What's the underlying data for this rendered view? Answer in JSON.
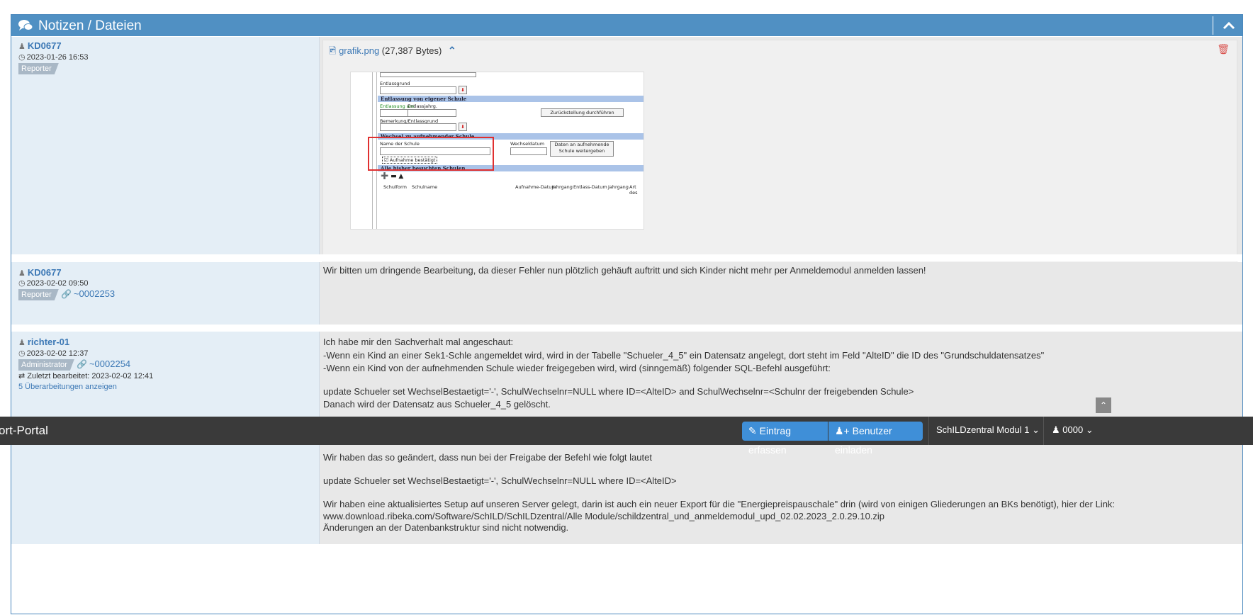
{
  "panel": {
    "title": "Notizen / Dateien"
  },
  "notes": [
    {
      "user": "KD0677",
      "date": "2023-01-26 16:53",
      "role": "Reporter",
      "file": {
        "name": "grafik.png",
        "size": "(27,387 Bytes)"
      }
    },
    {
      "user": "KD0677",
      "date": "2023-02-02 09:50",
      "role": "Reporter",
      "ref": "~0002253",
      "text": "Wir bitten um dringende Bearbeitung, da dieser Fehler nun plötzlich gehäuft auftritt und sich Kinder nicht mehr per Anmeldemodul anmelden lassen!"
    },
    {
      "user": "richter-01",
      "date": "2023-02-02 12:37",
      "role": "Administrator",
      "ref": "~0002254",
      "edited": "Zuletzt bearbeitet: 2023-02-02 12:41",
      "revisions": "5 Überarbeitungen anzeigen",
      "lines": [
        "Ich habe mir den Sachverhalt mal angeschaut:",
        "-Wenn ein Kind an einer Sek1-Schle angemeldet wird, wird in der Tabelle \"Schueler_4_5\" ein Datensatz angelegt, dort steht im Feld \"AlteID\" die ID des \"Grundschuldatensatzes\"",
        "-Wenn ein Kind von der aufnehmenden Schule wieder freigegeben wird, wird (sinngemäß) folgender SQL-Befehl ausgeführt:",
        "",
        "update Schueler set WechselBestaetigt='-', SchulWechselnr=NULL where ID=<AlteID> and SchulWechselnr=<Schulnr der freigebenden Schule>",
        "Danach wird der Datensatz aus Schueler_4_5 gelöscht."
      ],
      "lines2": [
        "Wir haben das so geändert, dass nun bei der Freigabe der Befehl wie folgt lautet",
        "",
        "update Schueler set WechselBestaetigt='-', SchulWechselnr=NULL where ID=<AlteID>",
        "",
        "Wir haben eine aktualisiertes Setup auf unseren Server gelegt, darin ist auch ein neuer Export für die \"Energiepreispauschale\" drin (wird von einigen Gliederungen an BKs benötigt), hier der Link:",
        "www.download.ribeka.com/Software/SchILD/SchILDzentral/Alle Module/schildzentral_und_anmeldemodul_upd_02.02.2023_2.0.29.10.zip",
        "Änderungen an der Datenbankstruktur sind nicht notwendig."
      ]
    }
  ],
  "screenshot": {
    "entlassgrund": "Entlassgrund",
    "section1": "Entlassung von eigener Schule",
    "entlassung_am": "Entlassung am",
    "entlassjahrg": "Entlassjahrg.",
    "zurueck_btn": "Zurückstellung durchführen",
    "bemerkung": "Bemerkung/Entlassgrund",
    "section2": "Wechsel zu aufnehmender Schule",
    "name_schule": "Name der Schule",
    "wechseldatum": "Wechseldatum",
    "daten_btn": "Daten an aufnehmende Schule weitergeben",
    "aufnahme": "Aufnahme bestätigt",
    "section3": "Alle bisher besuchten Schulen",
    "columns": [
      "Schulform",
      "Schulname",
      "Aufnahme-Datum",
      "Jahrgang",
      "Entlass-Datum",
      "Jahrgang",
      "Art des"
    ]
  },
  "topbar": {
    "brand": "ort-Portal",
    "create_label": "Eintrag erfassen",
    "invite_label": "Benutzer einladen",
    "project": "SchILDzentral Modul 1",
    "user": "0000"
  }
}
